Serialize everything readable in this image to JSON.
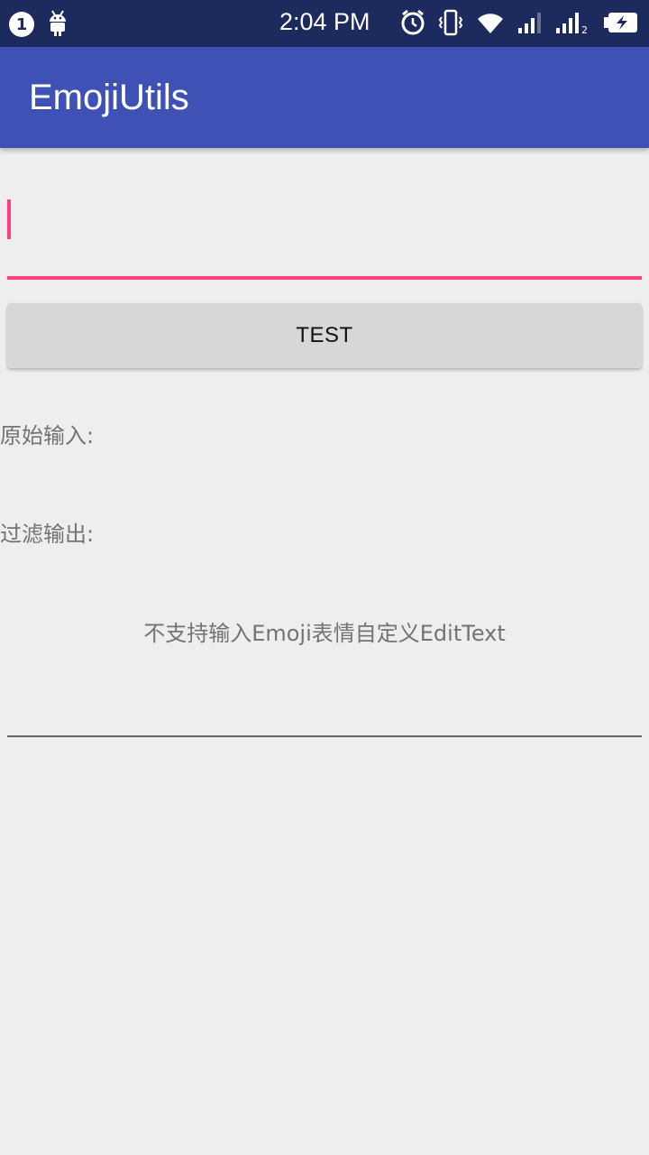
{
  "status_bar": {
    "notification_count": "1",
    "time": "2:04 PM",
    "icons": [
      "android-icon",
      "alarm-icon",
      "vibrate-icon",
      "wifi-icon",
      "signal-icon",
      "signal-2-icon",
      "battery-charging-icon"
    ]
  },
  "app_bar": {
    "title": "EmojiUtils",
    "color": "#3f51b5"
  },
  "input": {
    "value": "",
    "accent_color": "#ff4081"
  },
  "test_button": {
    "label": "TEST"
  },
  "labels": {
    "raw_input": "原始输入:",
    "filtered_output": "过滤输出:"
  },
  "emoji_edit_text": {
    "hint": "不支持输入Emoji表情自定义EditText"
  }
}
